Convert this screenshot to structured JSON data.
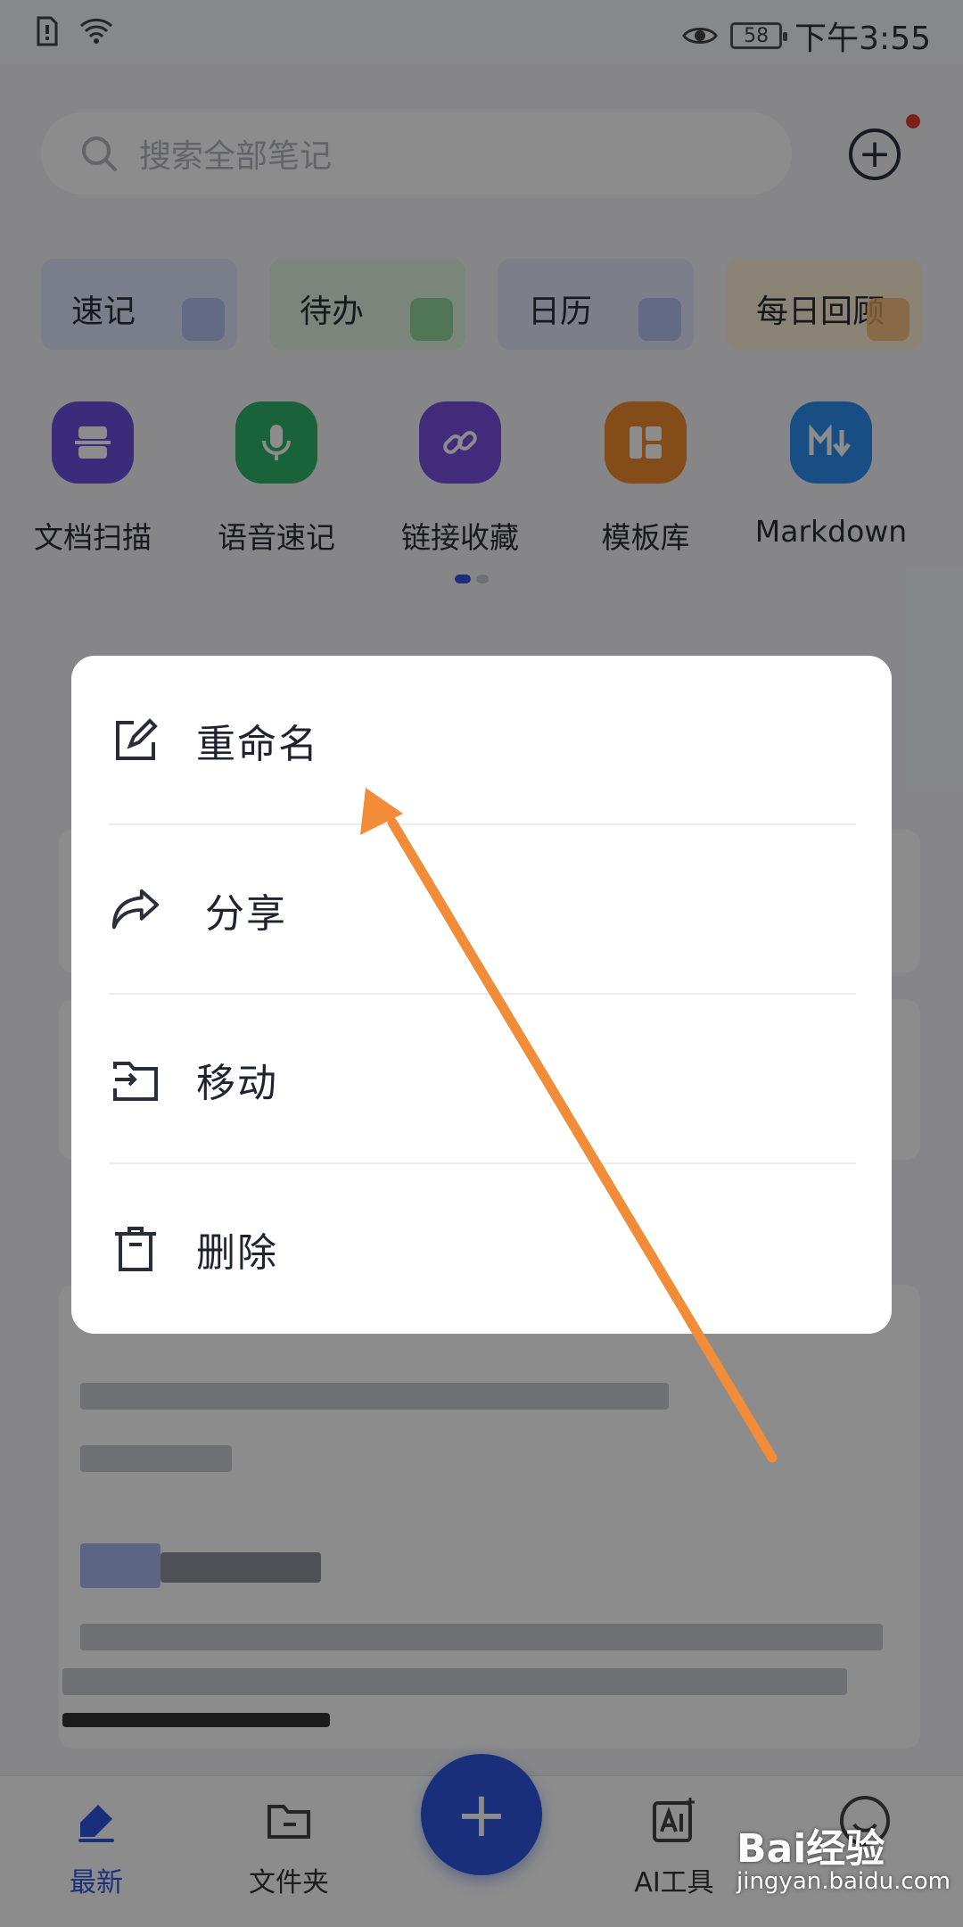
{
  "status_bar": {
    "time": "下午3:55",
    "battery": "58"
  },
  "search": {
    "placeholder": "搜索全部笔记"
  },
  "quick_cards": [
    {
      "label": "速记",
      "bg": "#dfe6fb",
      "icon_color": "#a9b8f0"
    },
    {
      "label": "待办",
      "bg": "#dff4e2",
      "icon_color": "#7fd08c"
    },
    {
      "label": "日历",
      "bg": "#e2e8fb",
      "icon_color": "#a9b8f0"
    },
    {
      "label": "每日回顾",
      "bg": "#fdeed6",
      "icon_color": "#f5b66b"
    }
  ],
  "tools": [
    {
      "label": "文档扫描",
      "color": "#6a4fe0",
      "icon": "scan-doc-icon"
    },
    {
      "label": "语音速记",
      "color": "#2fb36b",
      "icon": "microphone-icon"
    },
    {
      "label": "链接收藏",
      "color": "#7a4fe0",
      "icon": "link-icon"
    },
    {
      "label": "模板库",
      "color": "#f08a2c",
      "icon": "template-icon"
    },
    {
      "label": "Markdown",
      "color": "#2c8ef0",
      "icon": "markdown-icon"
    }
  ],
  "menu": {
    "items": [
      {
        "label": "重命名",
        "icon": "edit-icon"
      },
      {
        "label": "分享",
        "icon": "share-icon"
      },
      {
        "label": "移动",
        "icon": "move-folder-icon"
      },
      {
        "label": "删除",
        "icon": "trash-icon"
      }
    ]
  },
  "bottom_nav": {
    "items": [
      {
        "label": "最新",
        "active": true,
        "icon": "pencil-tag-icon"
      },
      {
        "label": "文件夹",
        "active": false,
        "icon": "folder-icon"
      },
      {
        "label": "AI工具",
        "active": false,
        "icon": "ai-icon"
      }
    ],
    "fab_label": "+"
  },
  "watermark": {
    "text": "Bai经验",
    "sub": "jingyan.baidu.com"
  },
  "annotation": {
    "arrow_color": "#f28c38"
  }
}
